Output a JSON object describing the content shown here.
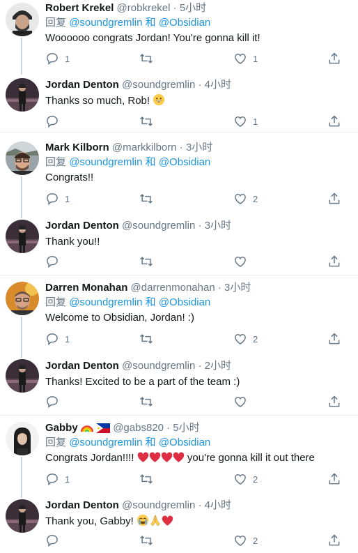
{
  "reply_prefix": "回复",
  "reply_and": "和",
  "tweets": [
    {
      "name": "Robert Krekel",
      "handle": "@robkrekel",
      "time": "5小时",
      "reply_to": [
        "@soundgremlin",
        "@Obsidian"
      ],
      "text": "Woooooo congrats Jordan! You're gonna kill it!",
      "replies": "1",
      "retweets": "",
      "likes": "1"
    },
    {
      "name": "Jordan Denton",
      "handle": "@soundgremlin",
      "time": "4小时",
      "text": "Thanks so much, Rob!",
      "replies": "",
      "retweets": "",
      "likes": "1"
    },
    {
      "name": "Mark Kilborn",
      "handle": "@markkilborn",
      "time": "3小时",
      "reply_to": [
        "@soundgremlin",
        "@Obsidian"
      ],
      "text": "Congrats!!",
      "replies": "1",
      "retweets": "",
      "likes": "2"
    },
    {
      "name": "Jordan Denton",
      "handle": "@soundgremlin",
      "time": "3小时",
      "text": "Thank you!!",
      "replies": "",
      "retweets": "",
      "likes": ""
    },
    {
      "name": "Darren Monahan",
      "handle": "@darrenmonahan",
      "time": "3小时",
      "reply_to": [
        "@soundgremlin",
        "@Obsidian"
      ],
      "text": "Welcome to Obsidian, Jordan! :)",
      "replies": "1",
      "retweets": "",
      "likes": "2"
    },
    {
      "name": "Jordan Denton",
      "handle": "@soundgremlin",
      "time": "2小时",
      "text": "Thanks! Excited to be a part of the team :)",
      "replies": "",
      "retweets": "",
      "likes": ""
    },
    {
      "name": "Gabby",
      "handle": "@gabs820",
      "time": "5小时",
      "reply_to": [
        "@soundgremlin",
        "@Obsidian"
      ],
      "text_before": "Congrats Jordan!!!!",
      "text_after": "you're gonna kill it out there",
      "replies": "1",
      "retweets": "",
      "likes": "2"
    },
    {
      "name": "Jordan Denton",
      "handle": "@soundgremlin",
      "time": "4小时",
      "text": "Thank you, Gabby!",
      "replies": "",
      "retweets": "",
      "likes": "2"
    }
  ],
  "icons": {
    "reply": "reply-icon",
    "retweet": "retweet-icon",
    "like": "heart-icon",
    "share": "share-icon"
  },
  "colors": {
    "link": "#1b95e0",
    "muted": "#657786",
    "heart": "#e0245e"
  }
}
